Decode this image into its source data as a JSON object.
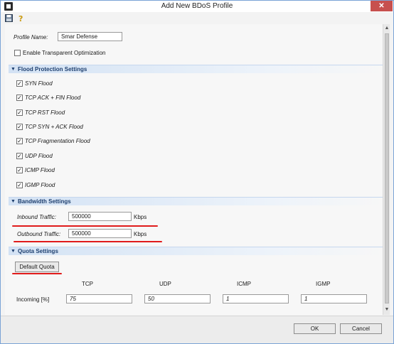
{
  "window": {
    "title": "Add New BDoS Profile",
    "close_label": "✕"
  },
  "toolbar": {
    "icons": [
      "save-icon",
      "help-icon"
    ]
  },
  "profile": {
    "name_label": "Profile Name:",
    "name_value": "Smar Defense",
    "transparent_label": "Enable Transparent Optimization",
    "transparent_checked": false
  },
  "flood": {
    "title": "Flood Protection Settings",
    "items": [
      {
        "label": "SYN Flood",
        "checked": true
      },
      {
        "label": "TCP ACK + FIN Flood",
        "checked": true
      },
      {
        "label": "TCP RST Flood",
        "checked": true
      },
      {
        "label": "TCP SYN + ACK Flood",
        "checked": true
      },
      {
        "label": "TCP Fragmentation Flood",
        "checked": true
      },
      {
        "label": "UDP Flood",
        "checked": true
      },
      {
        "label": "ICMP Flood",
        "checked": true
      },
      {
        "label": "IGMP Flood",
        "checked": true
      }
    ]
  },
  "bandwidth": {
    "title": "Bandwidth Settings",
    "inbound_label": "Inbound Traffic:",
    "inbound_value": "500000",
    "outbound_label": "Outbound Traffic:",
    "outbound_value": "500000",
    "unit": "Kbps"
  },
  "quota": {
    "title": "Quota Settings",
    "default_button": "Default Quota",
    "columns": [
      "TCP",
      "UDP",
      "ICMP",
      "IGMP"
    ],
    "row_label": "Incoming [%]",
    "values": [
      "75",
      "50",
      "1",
      "1"
    ]
  },
  "footer": {
    "ok_label": "OK",
    "cancel_label": "Cancel"
  },
  "colors": {
    "accent": "#1e3f6f",
    "highlight": "#e01b1b",
    "close": "#c7504e"
  }
}
